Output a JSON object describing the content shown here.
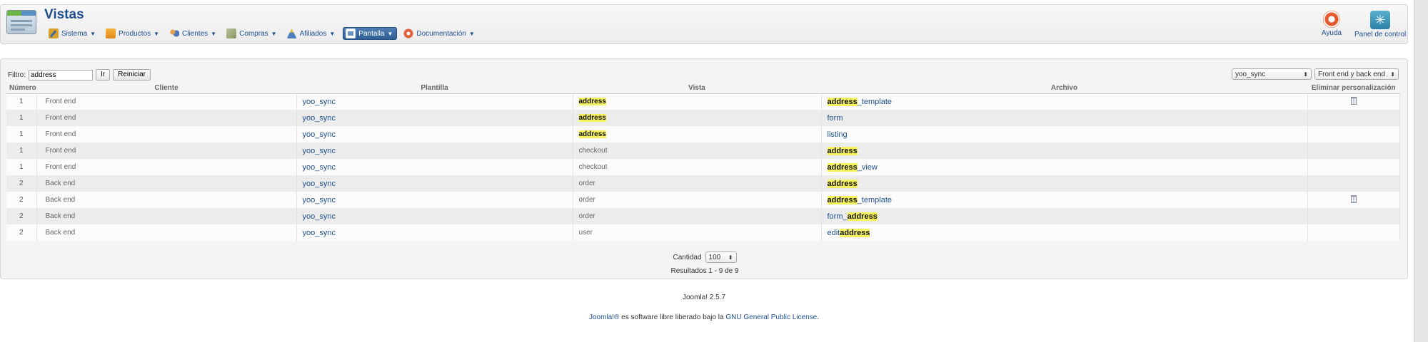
{
  "header": {
    "title": "Vistas",
    "menu": [
      {
        "label": "Sistema",
        "icon": "wrench-icon"
      },
      {
        "label": "Productos",
        "icon": "box-icon"
      },
      {
        "label": "Clientes",
        "icon": "people-icon"
      },
      {
        "label": "Compras",
        "icon": "cart-icon"
      },
      {
        "label": "Afiliados",
        "icon": "affiliate-icon"
      },
      {
        "label": "Pantalla",
        "icon": "screen-icon",
        "active": true
      },
      {
        "label": "Documentación",
        "icon": "help-icon"
      }
    ],
    "toolbar": {
      "help_label": "Ayuda",
      "control_panel_label": "Panel de control"
    }
  },
  "filter": {
    "label": "Filtro:",
    "value": "address",
    "go_label": "Ir",
    "reset_label": "Reiniciar",
    "template_select": "yoo_sync",
    "client_select": "Front end y back end"
  },
  "table": {
    "headers": {
      "number": "Número",
      "client": "Cliente",
      "template": "Plantilla",
      "view": "Vista",
      "file": "Archivo",
      "delete": "Eliminar personalización"
    },
    "rows": [
      {
        "number": "1",
        "client": "Front end",
        "template": "yoo_sync",
        "view": "address",
        "file": "address_template"
      },
      {
        "number": "1",
        "client": "Front end",
        "template": "yoo_sync",
        "view": "address",
        "file": "form"
      },
      {
        "number": "1",
        "client": "Front end",
        "template": "yoo_sync",
        "view": "address",
        "file": "listing"
      },
      {
        "number": "1",
        "client": "Front end",
        "template": "yoo_sync",
        "view": "checkout",
        "file": "address"
      },
      {
        "number": "1",
        "client": "Front end",
        "template": "yoo_sync",
        "view": "checkout",
        "file": "address_view"
      },
      {
        "number": "2",
        "client": "Back end",
        "template": "yoo_sync",
        "view": "order",
        "file": "address"
      },
      {
        "number": "2",
        "client": "Back end",
        "template": "yoo_sync",
        "view": "order",
        "file": "address_template"
      },
      {
        "number": "2",
        "client": "Back end",
        "template": "yoo_sync",
        "view": "order",
        "file": "form_address"
      },
      {
        "number": "2",
        "client": "Back end",
        "template": "yoo_sync",
        "view": "user",
        "file": "editaddress"
      }
    ]
  },
  "pagination": {
    "limit_label": "Cantidad",
    "limit_value": "100",
    "results": "Resultados 1 - 9 de 9"
  },
  "footer": {
    "version": "Joomla! 2.5.7",
    "license_link1": "Joomla!®",
    "license_text": " es software libre liberado bajo la ",
    "license_link2": "GNU General Public License."
  }
}
